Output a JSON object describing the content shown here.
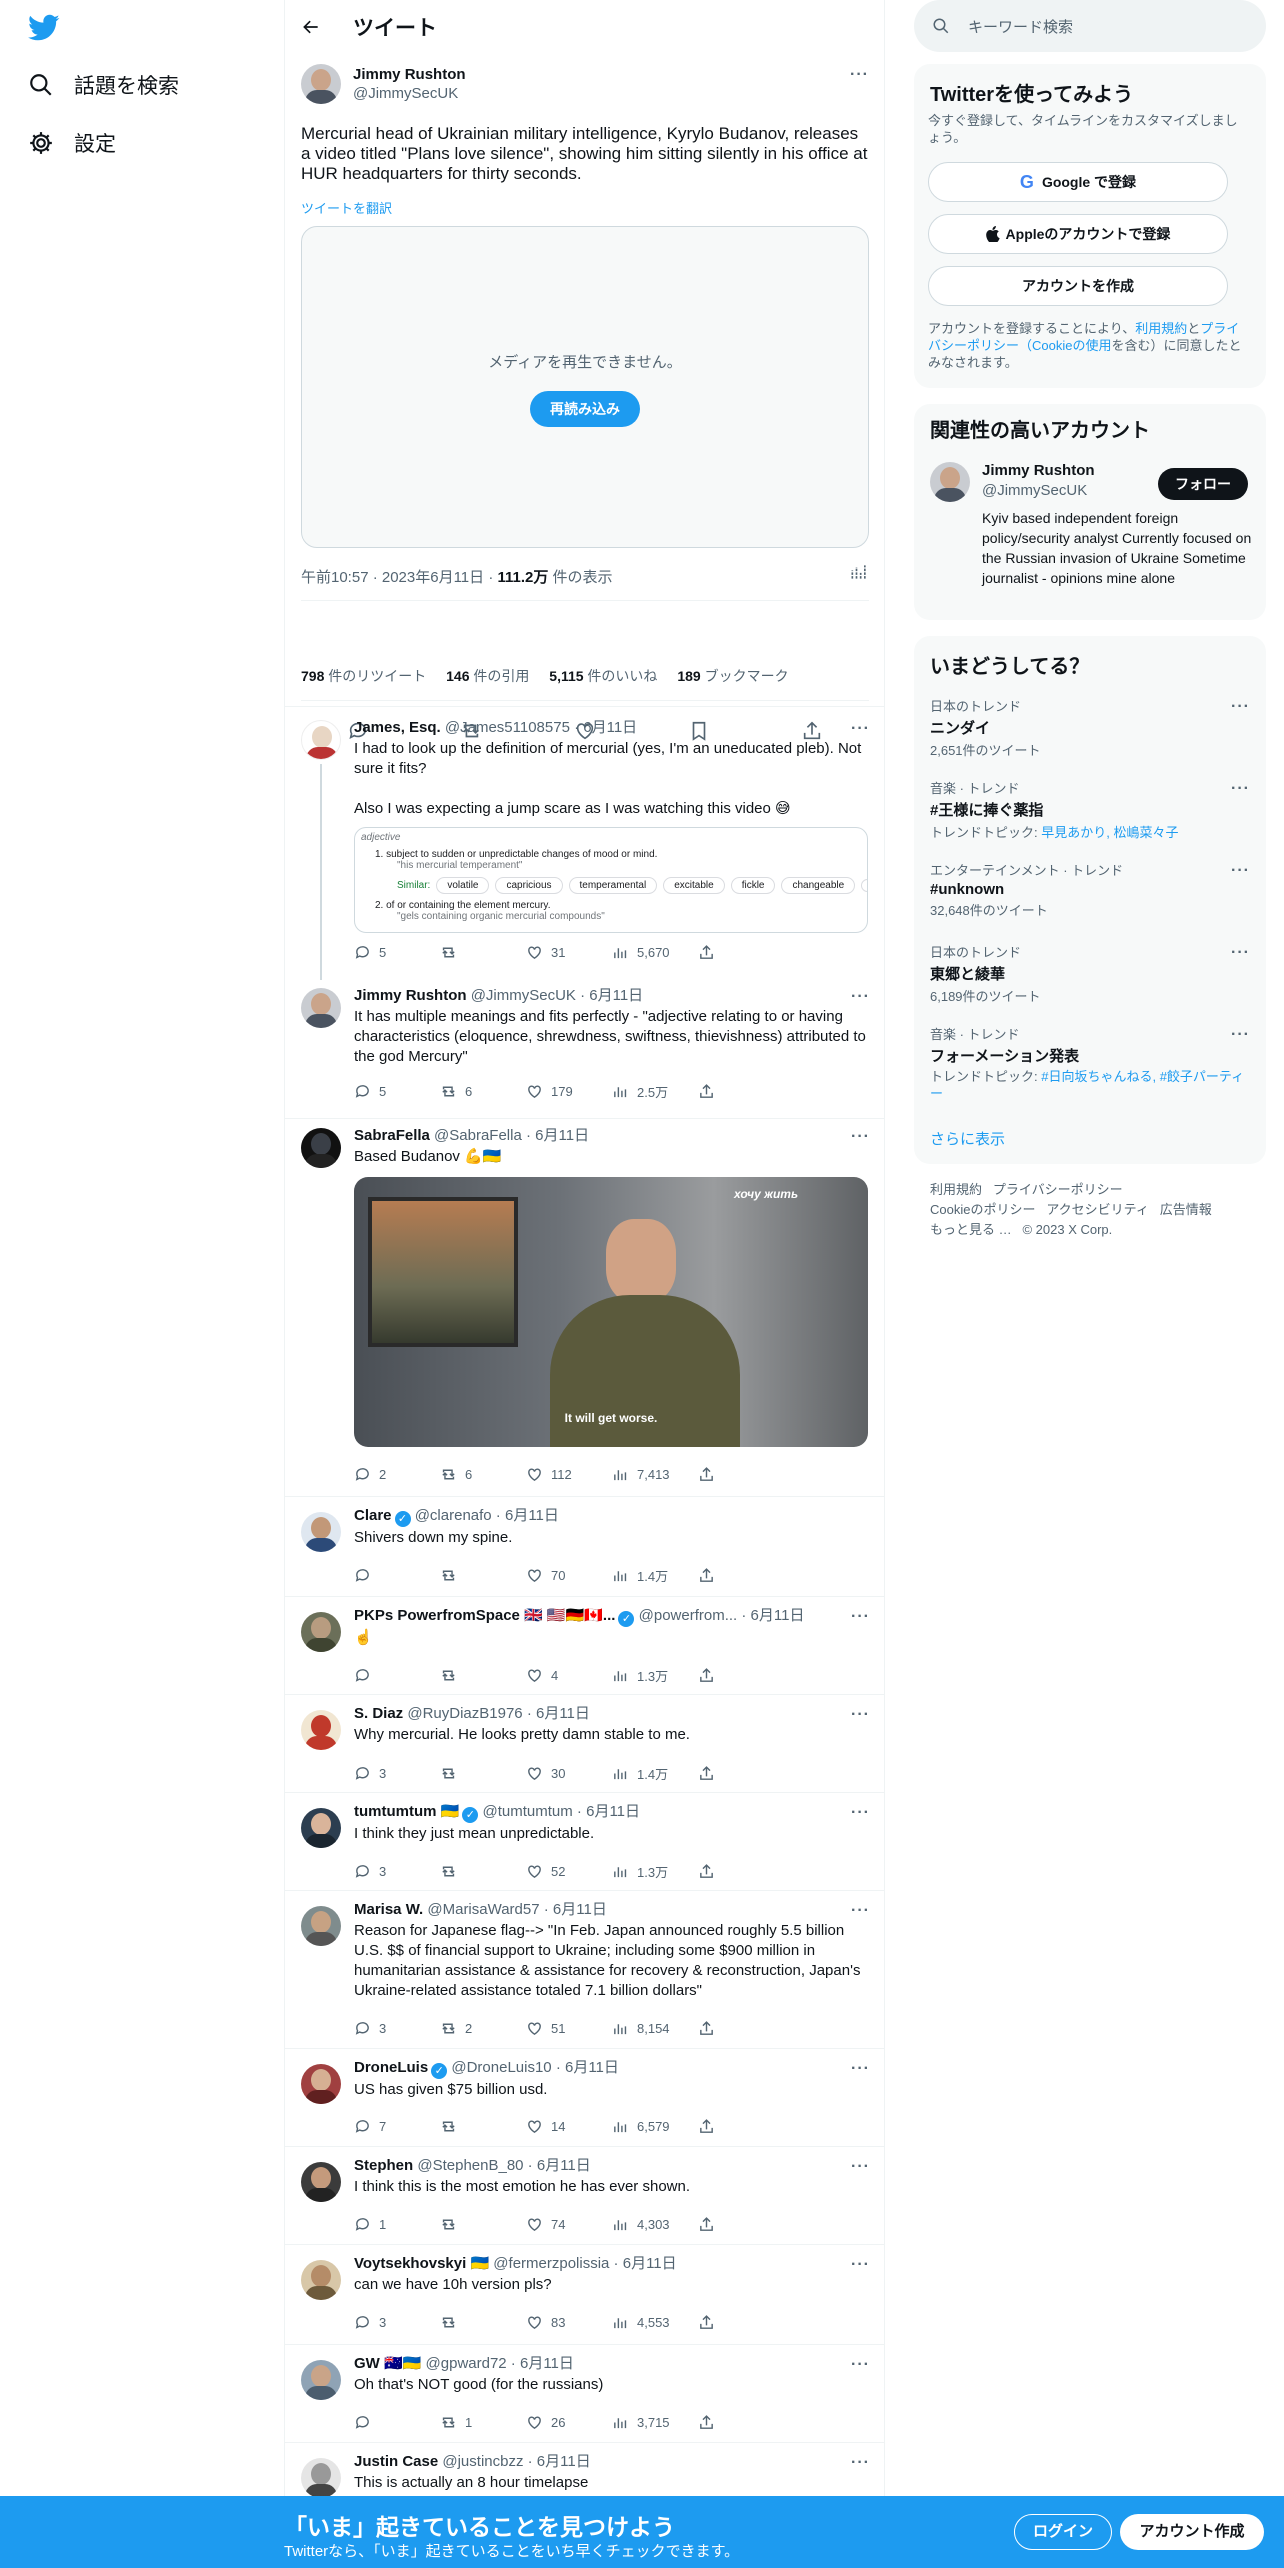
{
  "nav": {
    "search_label": "話題を検索",
    "settings_label": "設定"
  },
  "header": {
    "title": "ツイート"
  },
  "main_tweet": {
    "name": "Jimmy Rushton",
    "handle": "@JimmySecUK",
    "text": "Mercurial head of Ukrainian military intelligence, Kyrylo Budanov, releases a video titled \"Plans love silence\", showing him sitting silently in his office at HUR headquarters for thirty seconds.",
    "translate": "ツイートを翻訳",
    "media_message": "メディアを再生できません。",
    "media_reload": "再読み込み",
    "time": "午前10:57 · 2023年6月11日 · ",
    "views": "111.2万",
    "views_suffix": " 件の表示",
    "retweets": "798",
    "retweets_label": " 件のリツイート",
    "quotes": "146",
    "quotes_label": " 件の引用",
    "likes": "5,115",
    "likes_label": " 件のいいね",
    "bookmarks": "189",
    "bookmarks_label": " ブックマーク"
  },
  "replies": [
    {
      "name": "James, Esq.",
      "handle": "@James51108575",
      "date": " · 6月11日",
      "text": "I had to look up the definition of mercurial (yes, I'm an uneducated pleb). Not sure it fits?",
      "text2": "Also I was expecting a jump scare as I was watching this video 😅",
      "replies": "5",
      "retweets": "",
      "likes": "31",
      "views": "5,670"
    },
    {
      "name": "Jimmy Rushton",
      "handle": "@JimmySecUK",
      "date": " · 6月11日",
      "text": "It has multiple meanings and fits perfectly - \"adjective relating to or having characteristics (eloquence, shrewdness, swiftness, thievishness) attributed to the god Mercury\"",
      "replies": "5",
      "retweets": "6",
      "likes": "179",
      "views": "2.5万"
    },
    {
      "name": "SabraFella",
      "handle": "@SabraFella",
      "date": " · 6月11日",
      "text": "Based Budanov 💪🇺🇦",
      "replies": "2",
      "retweets": "6",
      "likes": "112",
      "views": "7,413",
      "image_caption": "It will get worse.",
      "image_logo": "хочу жить"
    },
    {
      "name": "Clare",
      "handle": "@clarenafo",
      "date": " · 6月11日",
      "text": "Shivers down my spine.",
      "replies": "",
      "retweets": "",
      "likes": "70",
      "views": "1.4万"
    },
    {
      "name": "PKPs PowerfromSpace 🇬🇧 🇺🇸🇩🇪🇨🇦...",
      "handle": "@powerfrom...",
      "date": " · 6月11日",
      "text": "☝️",
      "replies": "",
      "retweets": "",
      "likes": "4",
      "views": "1.3万"
    },
    {
      "name": "S. Diaz",
      "handle": "@RuyDiazB1976",
      "date": " · 6月11日",
      "text": "Why mercurial. He looks pretty damn stable to me.",
      "replies": "3",
      "retweets": "",
      "likes": "30",
      "views": "1.4万"
    },
    {
      "name": "tumtumtum 🇺🇦",
      "handle": "@tumtumtum",
      "date": " · 6月11日",
      "text": "I think they just mean unpredictable.",
      "replies": "3",
      "retweets": "",
      "likes": "52",
      "views": "1.3万"
    },
    {
      "name": "Marisa W.",
      "handle": "@MarisaWard57",
      "date": " · 6月11日",
      "text": "Reason for Japanese flag--> \"In Feb. Japan announced roughly 5.5 billion U.S. $$ of financial support to Ukraine; including some $900 million in humanitarian assistance & assistance for recovery & reconstruction, Japan's Ukraine-related assistance totaled 7.1 billion dollars\"",
      "replies": "3",
      "retweets": "2",
      "likes": "51",
      "views": "8,154"
    },
    {
      "name": "DroneLuis",
      "handle": "@DroneLuis10",
      "date": " · 6月11日",
      "text": "US has given $75 billion usd.",
      "replies": "7",
      "retweets": "",
      "likes": "14",
      "views": "6,579"
    },
    {
      "name": "Stephen",
      "handle": "@StephenB_80",
      "date": " · 6月11日",
      "text": "I think this is the most emotion he has ever shown.",
      "replies": "1",
      "retweets": "",
      "likes": "74",
      "views": "4,303"
    },
    {
      "name": "Voytsekhovskyi 🇺🇦",
      "handle": "@fermerzpolissia",
      "date": " · 6月11日",
      "text": "can we have 10h version pls?",
      "replies": "3",
      "retweets": "",
      "likes": "83",
      "views": "4,553"
    },
    {
      "name": "GW 🇦🇺🇺🇦",
      "handle": "@gpward72",
      "date": " · 6月11日",
      "text": "Oh that's NOT good (for the russians)",
      "replies": "",
      "retweets": "1",
      "likes": "26",
      "views": "3,715"
    },
    {
      "name": "Justin Case",
      "handle": "@justincbzz",
      "date": " · 6月11日",
      "text": "This is actually an 8 hour timelapse"
    }
  ],
  "definition": {
    "pos": "adjective",
    "d1": "subject to sudden or unpredictable changes of mood or mind.",
    "e1": "\"his mercurial temperament\"",
    "similar_label": "Similar:",
    "similar": [
      "volatile",
      "capricious",
      "temperamental",
      "excitable",
      "fickle",
      "changeable"
    ],
    "d2": "of or containing the element mercury.",
    "e2": "\"gels containing organic mercurial compounds\""
  },
  "right": {
    "search_placeholder": "キーワード検索",
    "signup": {
      "title": "Twitterを使ってみよう",
      "subtitle": "今すぐ登録して、タイムラインをカスタマイズしましょう。",
      "google": "Google で登録",
      "apple": "Appleのアカウントで登録",
      "create": "アカウントを作成",
      "terms_pre": "アカウントを登録することにより、",
      "terms_link": "利用規約",
      "terms_and": "と",
      "privacy_link": "プライバシーポリシー",
      "cookie_link": "（Cookieの使用",
      "terms_post": "を含む）に同意したとみなされます。"
    },
    "relevant": {
      "title": "関連性の高いアカウント",
      "name": "Jimmy Rushton",
      "handle": "@JimmySecUK",
      "follow": "フォロー",
      "bio": "Kyiv based independent foreign policy/security analyst Currently focused on the Russian invasion of Ukraine Sometime journalist - opinions mine alone"
    },
    "trends": {
      "title": "いまどうしてる？",
      "items": [
        {
          "category": "日本のトレンド",
          "title": "ニンダイ",
          "count": "2,651件のツイート"
        },
        {
          "category": "音楽 · トレンド",
          "title": "#王様に捧ぐ薬指",
          "count_prefix": "トレンドトピック: ",
          "count": "早見あかり, 松嶋菜々子"
        },
        {
          "category": "エンターテインメント · トレンド",
          "title": "#unknown",
          "count": "32,648件のツイート"
        },
        {
          "category": "日本のトレンド",
          "title": "東郷と綾華",
          "count": "6,189件のツイート"
        },
        {
          "category": "音楽 · トレンド",
          "title": "フォーメーション発表",
          "count_prefix": "トレンドトピック: ",
          "count": "#日向坂ちゃんねる, #餃子パーティー"
        }
      ],
      "show_more": "さらに表示"
    },
    "footer": {
      "terms": "利用規約",
      "privacy": "プライバシーポリシー",
      "cookie": "Cookieのポリシー",
      "accessibility": "アクセシビリティ",
      "ads": "広告情報",
      "more": "もっと見る …",
      "copyright": "© 2023 X Corp."
    }
  },
  "bottom": {
    "title": "「いま」起きていることを見つけよう",
    "subtitle": "Twitterなら、「いま」起きていることをいち早くチェックできます。",
    "login": "ログイン",
    "signup": "アカウント作成"
  },
  "colors": {
    "accent": "#1d9bf0",
    "text": "#0f1419",
    "secondary": "#536471"
  }
}
